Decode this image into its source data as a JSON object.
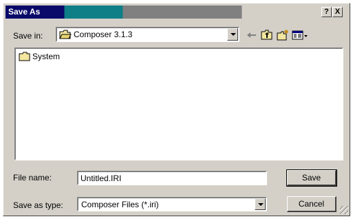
{
  "dialog": {
    "title": "Save As",
    "help_button": "?",
    "close_button": "X"
  },
  "save_in": {
    "label": "Save in:",
    "value": "Composer 3.1.3"
  },
  "toolbar": {
    "icons": [
      "back-arrow-icon",
      "up-folder-icon",
      "new-folder-icon",
      "view-menu-icon"
    ]
  },
  "files": [
    {
      "name": "System",
      "icon": "folder-icon"
    }
  ],
  "file_name": {
    "label": "File name:",
    "value": "Untitled.IRI"
  },
  "save_as_type": {
    "label": "Save as type:",
    "value": "Composer Files (*.iri)"
  },
  "buttons": {
    "save": "Save",
    "cancel": "Cancel"
  }
}
